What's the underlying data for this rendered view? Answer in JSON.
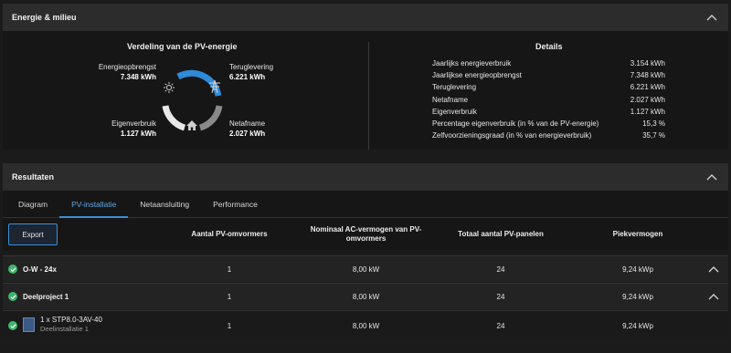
{
  "energy_panel": {
    "title": "Energie & milieu",
    "distribution": {
      "title": "Verdeling van de PV-energie",
      "production_label": "Energieopbrengst",
      "production_value": "7.348 kWh",
      "feed_in_label": "Teruglevering",
      "feed_in_value": "6.221 kWh",
      "self_consumption_label": "Eigenverbruik",
      "self_consumption_value": "1.127 kWh",
      "grid_draw_label": "Netafname",
      "grid_draw_value": "2.027 kWh",
      "colors": {
        "feed_in": "#2f8ad8",
        "consumption": "#e8e8e8",
        "grid": "#8a8a8a"
      }
    },
    "details": {
      "title": "Details",
      "rows": [
        {
          "label": "Jaarlijks energieverbruik",
          "value": "3.154 kWh"
        },
        {
          "label": "Jaarlijkse energieopbrengst",
          "value": "7.348 kWh"
        },
        {
          "label": "Teruglevering",
          "value": "6.221 kWh"
        },
        {
          "label": "Netafname",
          "value": "2.027 kWh"
        },
        {
          "label": "Eigenverbruik",
          "value": "1.127 kWh"
        },
        {
          "label": "Percentage eigenverbruik (in % van de PV-energie)",
          "value": "15,3 %"
        },
        {
          "label": "Zelfvoorzieningsgraad (in % van energieverbruik)",
          "value": "35,7 %"
        }
      ]
    }
  },
  "results_panel": {
    "title": "Resultaten",
    "tabs": [
      {
        "label": "Diagram"
      },
      {
        "label": "PV-installatie"
      },
      {
        "label": "Netaansluiting"
      },
      {
        "label": "Performance"
      }
    ],
    "active_tab": "PV-installatie",
    "export_label": "Export",
    "columns": {
      "inverters": "Aantal PV-omvormers",
      "ac_power": "Nominaal AC-vermogen van PV-omvormers",
      "panels": "Totaal aantal PV-panelen",
      "peak": "Piekvermogen"
    },
    "rows": [
      {
        "name": "O-W - 24x",
        "inverters": "1",
        "ac_power": "8,00 kW",
        "panels": "24",
        "peak": "9,24 kWp"
      },
      {
        "name": "Deelproject 1",
        "inverters": "1",
        "ac_power": "8,00 kW",
        "panels": "24",
        "peak": "9,24 kWp"
      },
      {
        "name": "1 x STP8.0-3AV-40",
        "sub": "Deelinstallatie 1",
        "inverters": "1",
        "ac_power": "8,00 kW",
        "panels": "24",
        "peak": "9,24 kWp"
      }
    ]
  }
}
